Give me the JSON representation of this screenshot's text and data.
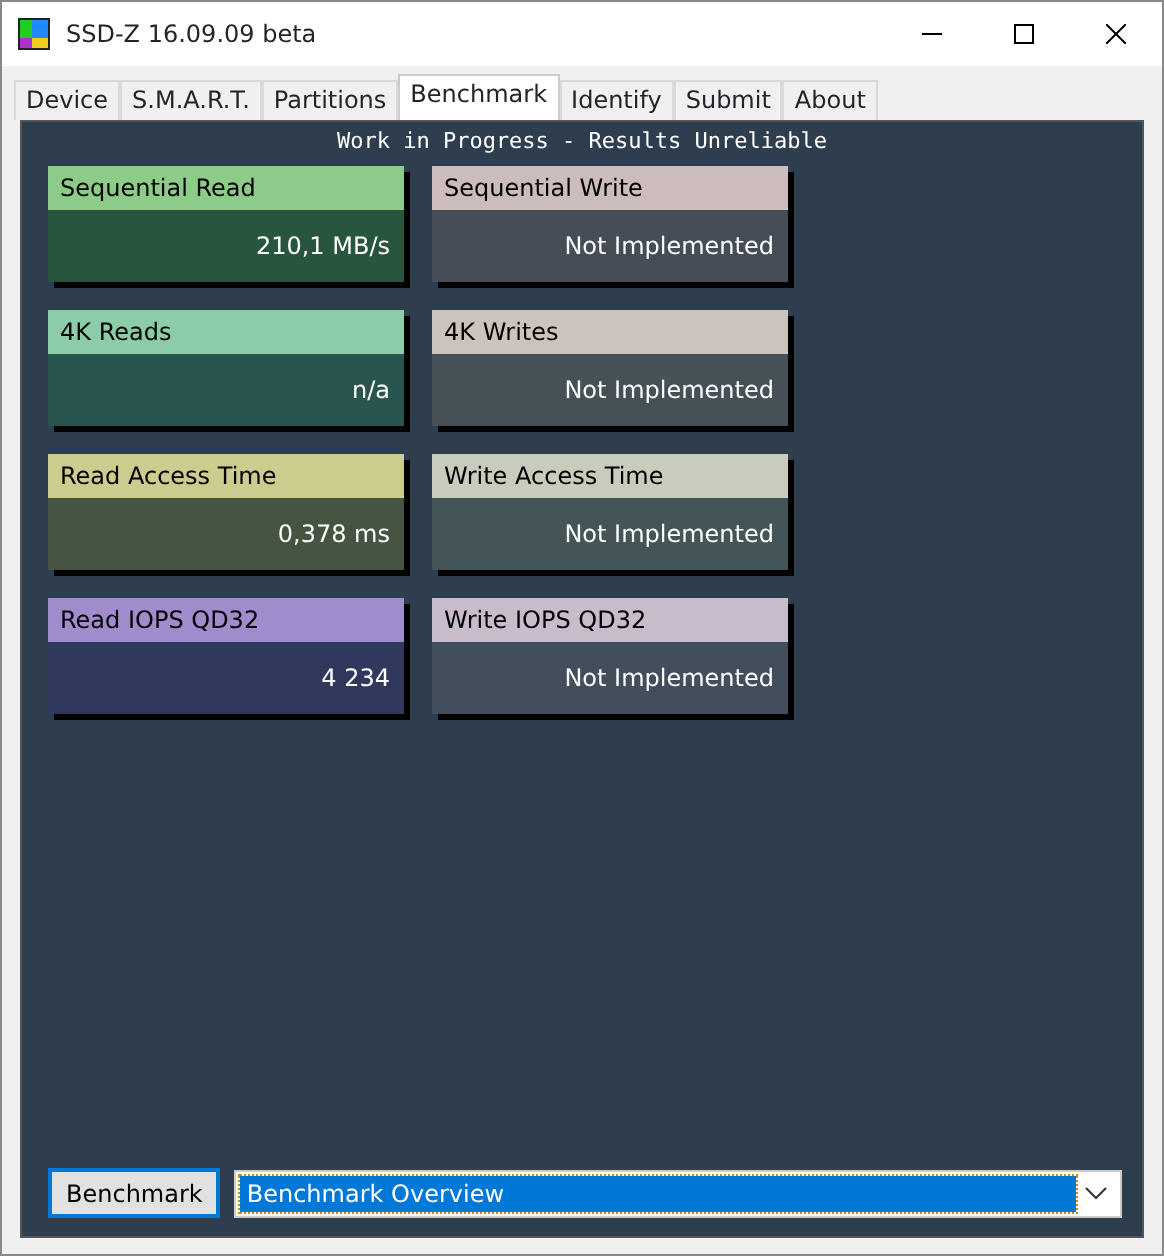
{
  "window": {
    "title": "SSD-Z 16.09.09 beta"
  },
  "tabs": [
    {
      "label": "Device",
      "selected": false
    },
    {
      "label": "S.M.A.R.T.",
      "selected": false
    },
    {
      "label": "Partitions",
      "selected": false
    },
    {
      "label": "Benchmark",
      "selected": true
    },
    {
      "label": "Identify",
      "selected": false
    },
    {
      "label": "Submit",
      "selected": false
    },
    {
      "label": "About",
      "selected": false
    }
  ],
  "banner": "Work in Progress - Results Unreliable",
  "results": [
    {
      "label": "Sequential Read",
      "value": "210,1 MB/s",
      "color": "#8ccc88"
    },
    {
      "label": "Sequential Write",
      "value": "Not Implemented",
      "color": "#ccbcbc"
    },
    {
      "label": "4K Reads",
      "value": "n/a",
      "color": "#8ccca8"
    },
    {
      "label": "4K Writes",
      "value": "Not Implemented",
      "color": "#ccc4bc"
    },
    {
      "label": "Read Access Time",
      "value": "0,378 ms",
      "color": "#cccc8e"
    },
    {
      "label": "Write Access Time",
      "value": "Not Implemented",
      "color": "#c8ccbc"
    },
    {
      "label": "Read IOPS QD32",
      "value": "4 234",
      "color": "#a08ccc"
    },
    {
      "label": "Write IOPS QD32",
      "value": "Not Implemented",
      "color": "#c8bccc"
    }
  ],
  "benchmark_button": "Benchmark",
  "mode_select": {
    "value": "Benchmark Overview"
  }
}
